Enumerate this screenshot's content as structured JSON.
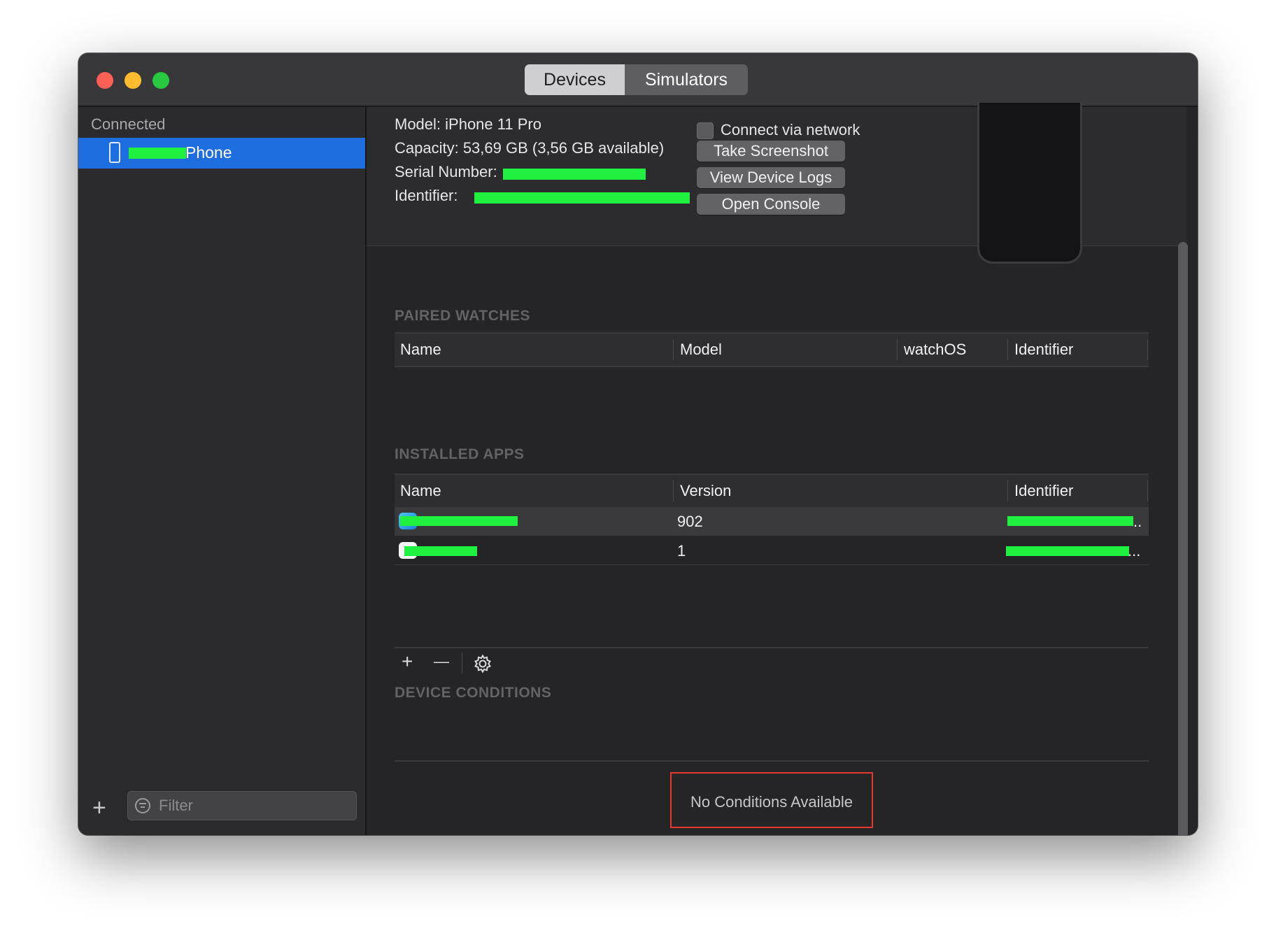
{
  "window": {
    "segments": [
      "Devices",
      "Simulators"
    ]
  },
  "sidebar": {
    "header": "Connected",
    "device_label": "Phone",
    "add_label": "+",
    "filter_placeholder": "Filter"
  },
  "device_info": {
    "model": "Model: iPhone 11 Pro",
    "capacity": "Capacity: 53,69 GB (3,56 GB available)",
    "serial": "Serial Number:",
    "identifier": "Identifier:",
    "connect_network": "Connect via network",
    "buttons": [
      "Take Screenshot",
      "View Device Logs",
      "Open Console"
    ]
  },
  "paired_watches": {
    "title": "PAIRED WATCHES",
    "columns": [
      "Name",
      "Model",
      "watchOS",
      "Identifier"
    ]
  },
  "installed_apps": {
    "title": "INSTALLED APPS",
    "columns": [
      "Name",
      "Version",
      "Identifier"
    ],
    "rows": [
      {
        "version": "902",
        "identifier_suffix": ".."
      },
      {
        "version": "1",
        "identifier_suffix": "..."
      }
    ]
  },
  "toolbar": {
    "add": "+",
    "remove": "—"
  },
  "device_conditions": {
    "title": "DEVICE CONDITIONS",
    "empty_text": "No Conditions Available"
  },
  "colors": {
    "selection": "#1f6ee0",
    "redaction": "#20f040",
    "highlight_box": "#e8392d"
  }
}
